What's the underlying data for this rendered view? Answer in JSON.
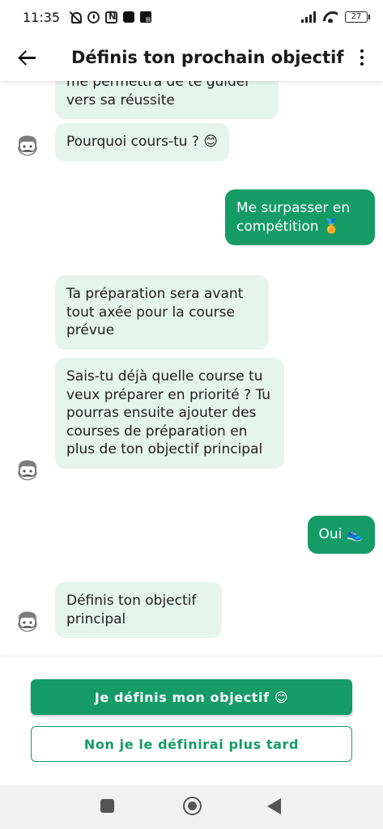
{
  "status_bar": {
    "time": "11:35",
    "battery": "27"
  },
  "app_bar": {
    "title": "Définis ton prochain objectif"
  },
  "messages": [
    {
      "from": "bot",
      "text": "me permettra de te guider vers sa réussite"
    },
    {
      "from": "bot",
      "text": "Pourquoi cours-tu ? 😊"
    },
    {
      "from": "user",
      "text": "Me surpasser en compétition 🏅"
    },
    {
      "from": "bot",
      "text": "Ta préparation sera avant tout axée pour la course prévue"
    },
    {
      "from": "bot",
      "text": "Sais-tu déjà quelle course tu veux préparer en priorité ? Tu pourras ensuite ajouter des courses de préparation en plus de ton objectif principal"
    },
    {
      "from": "user",
      "text": "Oui 👟"
    },
    {
      "from": "bot",
      "text": "Définis ton objectif principal"
    }
  ],
  "actions": {
    "primary_label": "Je définis mon objectif 😊",
    "secondary_label": "Non je le définirai plus tard"
  },
  "colors": {
    "accent": "#149b66",
    "bot_bubble": "#e6f4ee",
    "avatar_grey": "#7d7d7d"
  },
  "icons": {
    "status": [
      "mute-icon",
      "alarm-icon",
      "nfc-icon",
      "app-icon",
      "gallery-icon",
      "signal-icon",
      "wifi-icon",
      "battery-icon"
    ],
    "app_bar": [
      "back-arrow-icon",
      "more-vert-icon"
    ],
    "avatar": "bearded-coach-avatar",
    "nav": [
      "recents-icon",
      "home-icon",
      "nav-back-icon"
    ]
  }
}
